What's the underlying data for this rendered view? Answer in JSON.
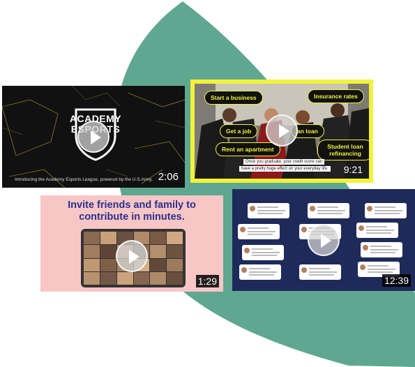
{
  "videos": [
    {
      "id": "academy",
      "caption": "Introducing the Academy Esports League, powered by the U.S.Army.",
      "logo_text": "ACADEMY ESPORTS",
      "duration": "2:06"
    },
    {
      "id": "graduation",
      "duration": "9:21",
      "pills": [
        "Start a business",
        "Insurance rates",
        "Get a job",
        "an loan",
        "Rent an apartment",
        "Student loan refinancing"
      ],
      "subtitle_line1": "Once you graduate, your credit score can",
      "subtitle_line2": "have a pretty huge effect on your everyday life."
    },
    {
      "id": "invite",
      "headline_line1": "Invite friends and family to",
      "headline_line2_plain": "contribute ",
      "headline_line2_bold": "in minutes.",
      "duration": "1:29"
    },
    {
      "id": "social",
      "duration": "12:39"
    }
  ],
  "colors": {
    "teal_shape": "#5fa790",
    "yellow": "#f2f23a",
    "pink": "#f9c6c6",
    "navy": "#1e2a5a",
    "headline_blue": "#2a2f8f"
  }
}
